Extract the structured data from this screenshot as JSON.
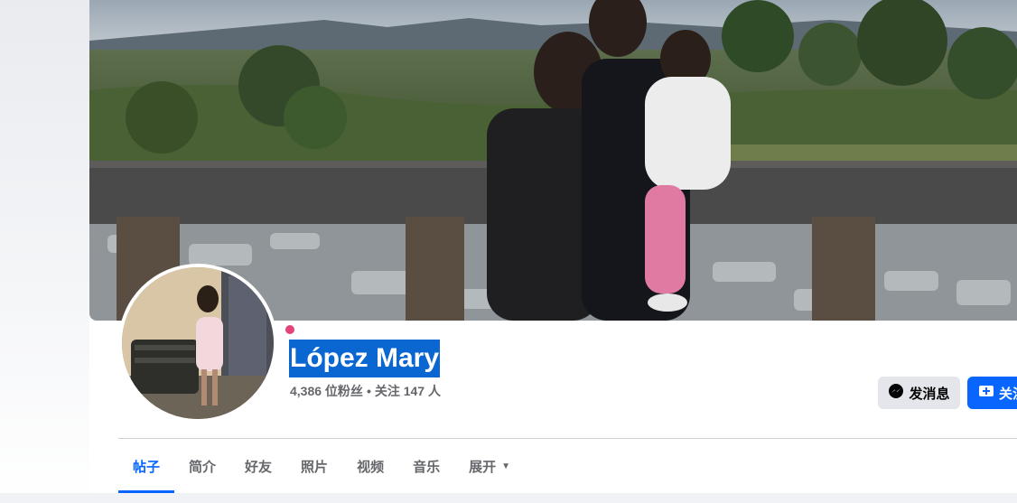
{
  "profile": {
    "name": "López Mary",
    "followers": "4,386 位粉丝",
    "separator": "•",
    "following": "关注 147 人"
  },
  "actions": {
    "message_label": "发消息",
    "follow_label": "关注"
  },
  "tabs": [
    {
      "label": "帖子",
      "active": true
    },
    {
      "label": "简介",
      "active": false
    },
    {
      "label": "好友",
      "active": false
    },
    {
      "label": "照片",
      "active": false
    },
    {
      "label": "视频",
      "active": false
    },
    {
      "label": "音乐",
      "active": false
    },
    {
      "label": "展开",
      "active": false
    }
  ],
  "colors": {
    "accent": "#0866ff",
    "name_highlight": "#0a66d0",
    "online_dot": "#e4447a",
    "secondary_text": "#65676b"
  },
  "icons": {
    "message": "messenger-icon",
    "follow": "add-friend-icon",
    "more": "caret-down-icon"
  }
}
